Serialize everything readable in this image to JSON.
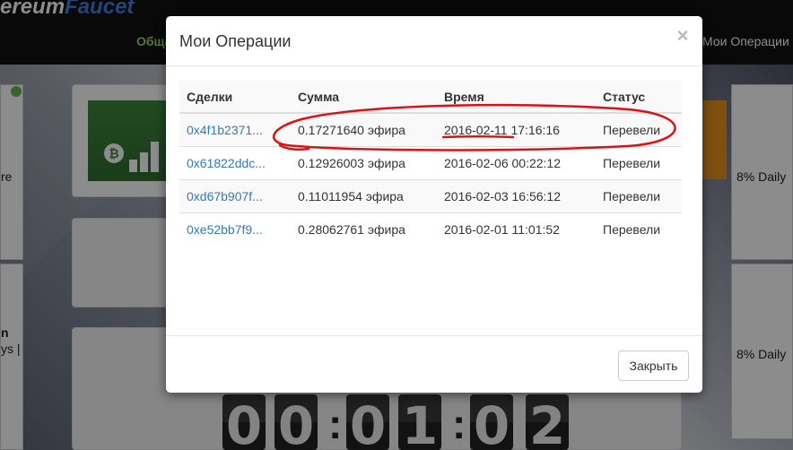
{
  "navbar": {
    "brand_left": "ereum",
    "brand_right": "Faucet",
    "link_left": "Обща",
    "link_right": "Мои Операции"
  },
  "page": {
    "side_left_1_text": "re",
    "side_left_2_text_1": "n",
    "side_left_2_text_2": "ys |",
    "side_right_1_text": "8% Daily",
    "side_right_2_text": "8% Daily",
    "countdown": [
      "0",
      "0",
      ":",
      "0",
      "1",
      ":",
      "0",
      "2"
    ]
  },
  "modal": {
    "title": "Мои Операции",
    "close_symbol": "×",
    "close_button": "Закрыть",
    "columns": [
      "Сделки",
      "Сумма",
      "Время",
      "Статус"
    ],
    "rows": [
      {
        "tx": "0x4f1b2371...",
        "amount": "0.17271640 эфира",
        "time": "2016-02-11 17:16:16",
        "status": "Перевели"
      },
      {
        "tx": "0x61822ddc...",
        "amount": "0.12926003 эфира",
        "time": "2016-02-06 00:22:12",
        "status": "Перевели"
      },
      {
        "tx": "0xd67b907f...",
        "amount": "0.11011954 эфира",
        "time": "2016-02-03 16:56:12",
        "status": "Перевели"
      },
      {
        "tx": "0xe52bb7f9...",
        "amount": "0.28062761 эфира",
        "time": "2016-02-01 11:01:52",
        "status": "Перевели"
      }
    ]
  },
  "colors": {
    "link": "#337ab7",
    "annotation": "#e01010",
    "brand_accent": "#3e7ee0"
  },
  "icons": [
    "close-icon",
    "bitcoin-chart-icon",
    "tree-icon"
  ]
}
